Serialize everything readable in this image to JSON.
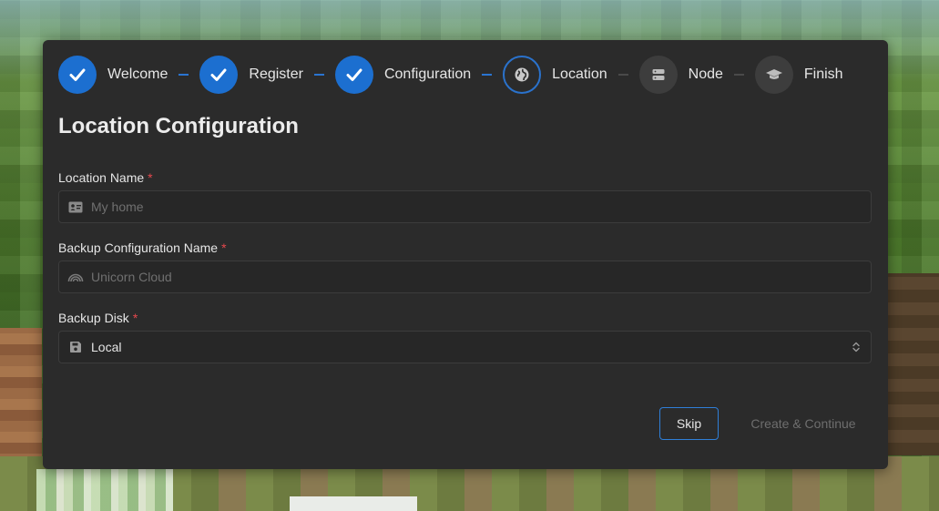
{
  "stepper": {
    "steps": [
      {
        "label": "Welcome",
        "status": "completed",
        "icon": "check-icon"
      },
      {
        "label": "Register",
        "status": "completed",
        "icon": "check-icon"
      },
      {
        "label": "Configuration",
        "status": "completed",
        "icon": "check-icon"
      },
      {
        "label": "Location",
        "status": "active",
        "icon": "globe-icon"
      },
      {
        "label": "Node",
        "status": "pending",
        "icon": "server-icon"
      },
      {
        "label": "Finish",
        "status": "pending",
        "icon": "graduation-cap-icon"
      }
    ]
  },
  "form": {
    "title": "Location Configuration",
    "location_name": {
      "label": "Location Name",
      "required_mark": "*",
      "placeholder": "My home",
      "icon": "id-card-icon"
    },
    "backup_config_name": {
      "label": "Backup Configuration Name",
      "required_mark": "*",
      "placeholder": "Unicorn Cloud",
      "icon": "rainbow-icon"
    },
    "backup_disk": {
      "label": "Backup Disk",
      "required_mark": "*",
      "value": "Local",
      "icon": "floppy-disk-icon"
    }
  },
  "actions": {
    "skip_label": "Skip",
    "create_label": "Create & Continue"
  },
  "colors": {
    "accent": "#1c6fd0",
    "dialog_bg": "#2b2b2b",
    "required": "#e5484d"
  }
}
